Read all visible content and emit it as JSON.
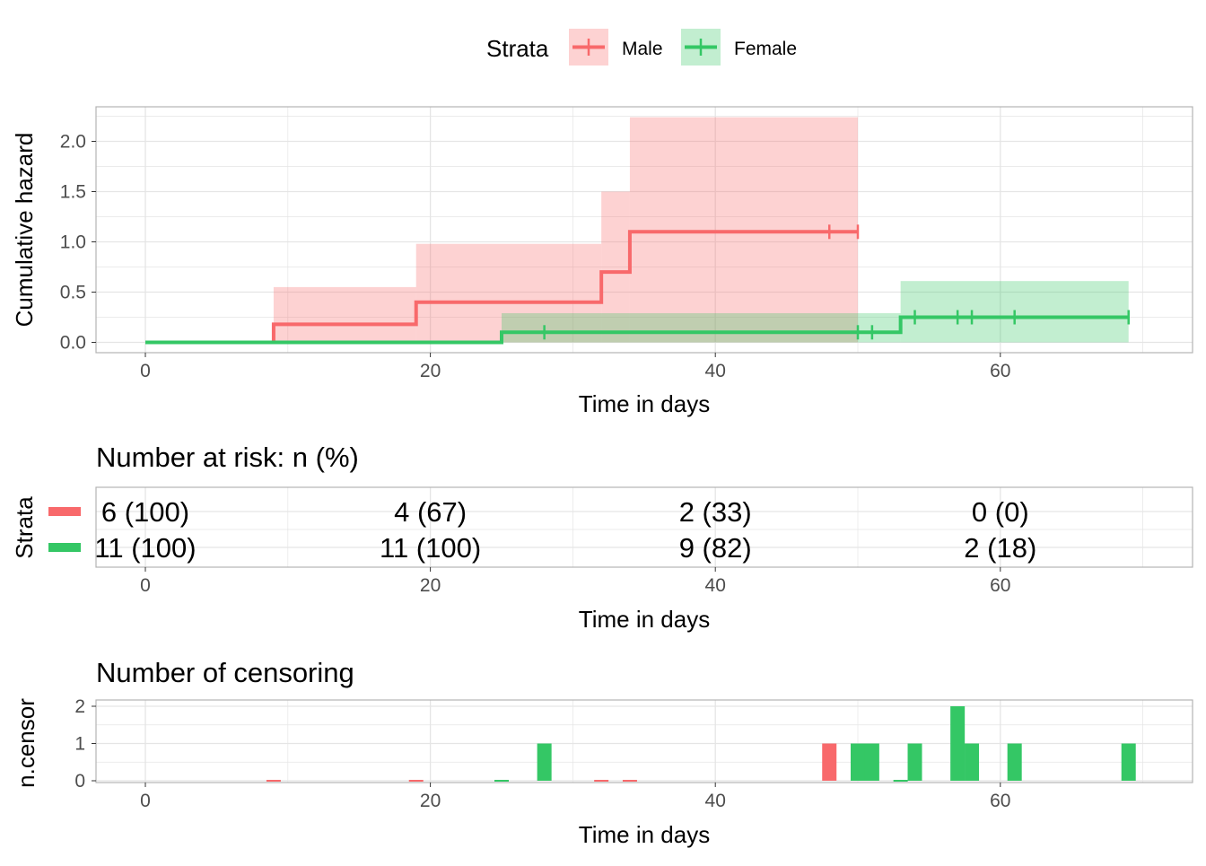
{
  "legend": {
    "title": "Strata",
    "placement": "top",
    "items": [
      {
        "label": "Male",
        "color": "#F8696B"
      },
      {
        "label": "Female",
        "color": "#34C765"
      }
    ]
  },
  "colors": {
    "male": "#F8696B",
    "female": "#34C765",
    "grid": "#E5E5E5",
    "border": "#B3B3B3",
    "tick_text": "#4D4D4D"
  },
  "chart_data": [
    {
      "type": "line",
      "subtype": "step",
      "title": "",
      "xlabel": "Time in days",
      "ylabel": "Cumulative hazard",
      "xlim": [
        -3.5,
        73
      ],
      "ylim": [
        -0.11,
        2.37
      ],
      "xticks": [
        0,
        20,
        40,
        60
      ],
      "yticks": [
        0.0,
        0.5,
        1.0,
        1.5,
        2.0
      ],
      "ytick_labels": [
        "0.0",
        "0.5",
        "1.0",
        "1.5",
        "2.0"
      ],
      "grid": true,
      "series": [
        {
          "name": "Male",
          "color": "#F8696B",
          "steps": [
            [
              0,
              0
            ],
            [
              9,
              0.18
            ],
            [
              19,
              0.4
            ],
            [
              32,
              0.7
            ],
            [
              34,
              1.1
            ],
            [
              50,
              1.1
            ]
          ],
          "ci_upper": [
            [
              9,
              0.55
            ],
            [
              19,
              0.98
            ],
            [
              32,
              1.5
            ],
            [
              34,
              2.24
            ],
            [
              50,
              2.24
            ]
          ],
          "censored": [
            48,
            50
          ]
        },
        {
          "name": "Female",
          "color": "#34C765",
          "steps": [
            [
              0,
              0
            ],
            [
              25,
              0.1
            ],
            [
              53,
              0.25
            ],
            [
              69,
              0.25
            ]
          ],
          "ci_upper": [
            [
              25,
              0.29
            ],
            [
              53,
              0.61
            ],
            [
              69,
              0.61
            ]
          ],
          "censored": [
            28,
            50,
            51,
            54,
            57,
            58,
            61,
            69
          ]
        }
      ]
    },
    {
      "type": "table",
      "title": "Number at risk: n (%)",
      "xlabel": "Time in days",
      "ylabel": "Strata",
      "xticks": [
        0,
        20,
        40,
        60
      ],
      "rows": [
        {
          "name": "Male",
          "color": "#F8696B",
          "cells": [
            "6 (100)",
            "4 (67)",
            "2 (33)",
            "0 (0)"
          ]
        },
        {
          "name": "Female",
          "color": "#34C765",
          "cells": [
            "11 (100)",
            "11 (100)",
            "9 (82)",
            "2 (18)"
          ]
        }
      ]
    },
    {
      "type": "bar",
      "title": "Number of censoring",
      "xlabel": "Time in days",
      "ylabel": "n.censor",
      "ylim": [
        0,
        2
      ],
      "xticks": [
        0,
        20,
        40,
        60
      ],
      "yticks": [
        0,
        1,
        2
      ],
      "series": [
        {
          "name": "Male",
          "color": "#F8696B",
          "x": [
            9,
            19,
            32,
            34,
            48,
            50
          ],
          "values": [
            0,
            0,
            0,
            0,
            1,
            1
          ]
        },
        {
          "name": "Female",
          "color": "#34C765",
          "x": [
            25,
            28,
            50,
            51,
            53,
            54,
            57,
            58,
            61,
            69
          ],
          "values": [
            0,
            1,
            1,
            1,
            0,
            1,
            2,
            1,
            1,
            1
          ]
        }
      ]
    }
  ]
}
